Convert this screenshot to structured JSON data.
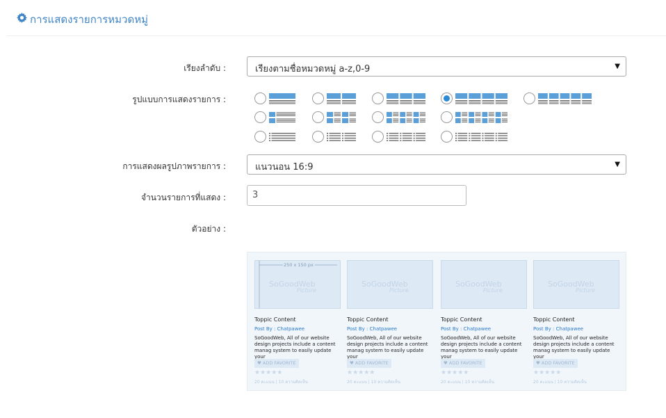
{
  "header": {
    "title": "การแสดงรายการหมวดหมู่",
    "icon": "gear-icon"
  },
  "sort": {
    "label": "เรียงลำดับ :",
    "value": "เรียงตามชื่อหมวดหมู่ a-z,0-9"
  },
  "layout": {
    "label": "รูปแบบการแสดงรายการ :",
    "selected_index": 3
  },
  "image_display": {
    "label": "การแสดงผลรูปภาพรายการ :",
    "value": "แนวนอน 16:9"
  },
  "count": {
    "label": "จำนวนรายการที่แสดง :",
    "value": "3"
  },
  "preview": {
    "label": "ตัวอย่าง :",
    "dimension_label": "250 x 150 px",
    "watermark": "SoGoodWeb",
    "watermark_sub": "Picture",
    "cards": [
      {
        "title": "Toppic Content",
        "post": "Post By : Chatpawee",
        "desc": "SoGoodWeb, All of our website design projects include a content manag system to easily update your",
        "fav": "ADD FAVORITE",
        "stars": "★★★★★",
        "stats": "20 คะแนน | 10 ความคิดเห็น"
      },
      {
        "title": "Toppic Content",
        "post": "Post By : Chatpawee",
        "desc": "SoGoodWeb, All of our website design projects include a content manag system to easily update your",
        "fav": "ADD FAVORITE",
        "stars": "★★★★★",
        "stats": "20 คะแนน | 10 ความคิดเห็น"
      },
      {
        "title": "Toppic Content",
        "post": "Post By : Chatpawee",
        "desc": "SoGoodWeb, All of our website design projects include a content manag system to easily update your",
        "fav": "ADD FAVORITE",
        "stars": "★★★★★",
        "stats": "20 คะแนน | 10 ความคิดเห็น"
      },
      {
        "title": "Toppic Content",
        "post": "Post By : Chatpawee",
        "desc": "SoGoodWeb, All of our website design projects include a content manag system to easily update your",
        "fav": "ADD FAVORITE",
        "stars": "★★★★★",
        "stats": "20 คะแนน | 10 ความคิดเห็น"
      }
    ]
  },
  "colors": {
    "accent": "#3e84c7",
    "radio_selected": "#2b8ad6",
    "icon_blue": "#5a9fd8"
  }
}
